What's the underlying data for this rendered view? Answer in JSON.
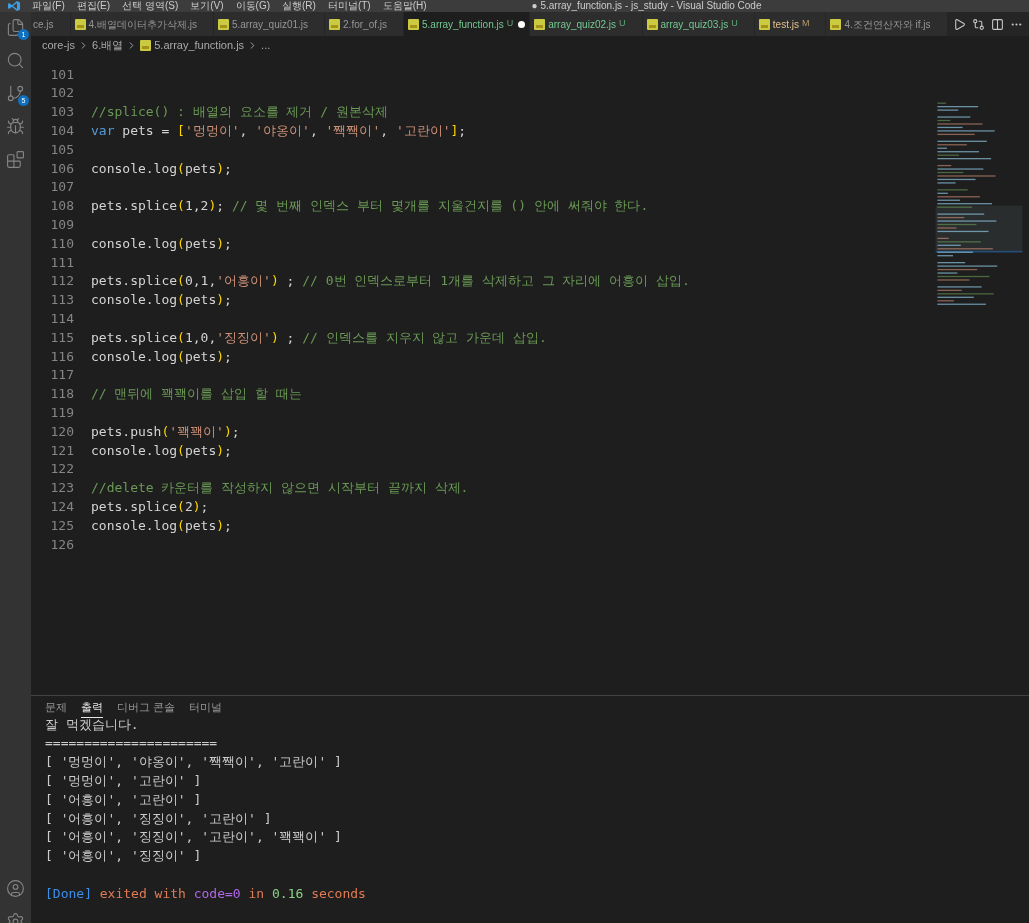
{
  "menu": [
    "파일(F)",
    "편집(E)",
    "선택 영역(S)",
    "보기(V)",
    "이동(G)",
    "실행(R)",
    "터미널(T)",
    "도움말(H)"
  ],
  "window": {
    "title": "● 5.array_function.js - js_study - Visual Studio Code"
  },
  "activity_bar": [
    {
      "kind": "files",
      "badge": "1",
      "selected": false
    },
    {
      "kind": "search",
      "selected": false
    },
    {
      "kind": "source-control",
      "badge": "5",
      "selected": false
    },
    {
      "kind": "debug",
      "selected": false
    },
    {
      "kind": "extensions",
      "selected": false
    }
  ],
  "tabs": [
    {
      "label": "ce.js",
      "kind": "clean",
      "selected": false,
      "dirty": false
    },
    {
      "label": "4.배열데이터추가삭제.js",
      "kind": "clean",
      "selected": false,
      "dirty": false
    },
    {
      "label": "5.array_quiz01.js",
      "kind": "clean",
      "selected": false,
      "dirty": false
    },
    {
      "label": "2.for_of.js",
      "kind": "clean",
      "selected": false,
      "dirty": false
    },
    {
      "label": "5.array_function.js",
      "kind": "untracked",
      "badge": "U",
      "selected": true,
      "dirty": true
    },
    {
      "label": "array_quiz02.js",
      "kind": "untracked",
      "badge": "U",
      "selected": false,
      "dirty": false
    },
    {
      "label": "array_quiz03.js",
      "kind": "untracked",
      "badge": "U",
      "selected": false,
      "dirty": false
    },
    {
      "label": "test.js",
      "kind": "modified",
      "badge": "M",
      "selected": false,
      "dirty": false
    },
    {
      "label": "4.조건연산자와 if.js",
      "kind": "clean",
      "selected": false,
      "dirty": false
    }
  ],
  "breadcrumb": [
    "core-js",
    "6.배열",
    "5.array_function.js",
    "..."
  ],
  "code_lines": [
    {
      "number": "101"
    },
    {
      "number": "102"
    },
    {
      "number": "103",
      "text": "//splice() : 배열의 요소를 제거 / 원본삭제"
    },
    {
      "number": "104",
      "text": "var pets = ['멍멍이', '야옹이', '짹짹이', '고란이'];"
    },
    {
      "number": "105"
    },
    {
      "number": "106",
      "text": "console.log(pets);"
    },
    {
      "number": "107"
    },
    {
      "number": "108",
      "text": "pets.splice(1,2); // 몇 번째 인덱스 부터 몇개를 지울건지를 () 안에 써줘야 한다."
    },
    {
      "number": "109"
    },
    {
      "number": "110",
      "text": "console.log(pets);"
    },
    {
      "number": "111"
    },
    {
      "number": "112",
      "text": "pets.splice(0,1,'어흥이') ; // 0번 인덱스로부터 1개를 삭제하고 그 자리에 어흥이 삽입."
    },
    {
      "number": "113",
      "text": "console.log(pets);"
    },
    {
      "number": "114"
    },
    {
      "number": "115",
      "text": "pets.splice(1,0,'징징이') ; // 인덱스를 지우지 않고 가운데 삽입."
    },
    {
      "number": "116",
      "text": "console.log(pets);"
    },
    {
      "number": "117"
    },
    {
      "number": "118",
      "text": "// 맨뒤에 꽥꽥이를 삽입 할 때는"
    },
    {
      "number": "119"
    },
    {
      "number": "120",
      "text": "pets.push('꽥꽥이');"
    },
    {
      "number": "121",
      "text": "console.log(pets);"
    },
    {
      "number": "122"
    },
    {
      "number": "123",
      "text": "//delete 카운터를 작성하지 않으면 시작부터 끝까지 삭제."
    },
    {
      "number": "124",
      "text": "pets.splice(2);"
    },
    {
      "number": "125",
      "text": "console.log(pets);"
    },
    {
      "number": "126"
    }
  ],
  "panel_tabs": [
    {
      "label": "문제",
      "selected": false
    },
    {
      "label": "출력",
      "selected": true
    },
    {
      "label": "디버그 콘솔",
      "selected": false
    },
    {
      "label": "터미널",
      "selected": false
    }
  ],
  "output_lines": [
    {
      "kind": "log",
      "text": "잘 먹겠습니다."
    },
    {
      "kind": "log",
      "text": "======================"
    },
    {
      "kind": "log",
      "text": "[ '멍멍이', '야옹이', '짹짹이', '고란이' ]"
    },
    {
      "kind": "log",
      "text": "[ '멍멍이', '고란이' ]"
    },
    {
      "kind": "log",
      "text": "[ '어흥이', '고란이' ]"
    },
    {
      "kind": "log",
      "text": "[ '어흥이', '징징이', '고란이' ]"
    },
    {
      "kind": "log",
      "text": "[ '어흥이', '징징이', '고란이', '꽥꽥이' ]"
    },
    {
      "kind": "log",
      "text": "[ '어흥이', '징징이' ]"
    },
    {
      "kind": "blank"
    },
    {
      "kind": "done",
      "text": "[Done] exited with code=0 in 0.16 seconds"
    }
  ]
}
